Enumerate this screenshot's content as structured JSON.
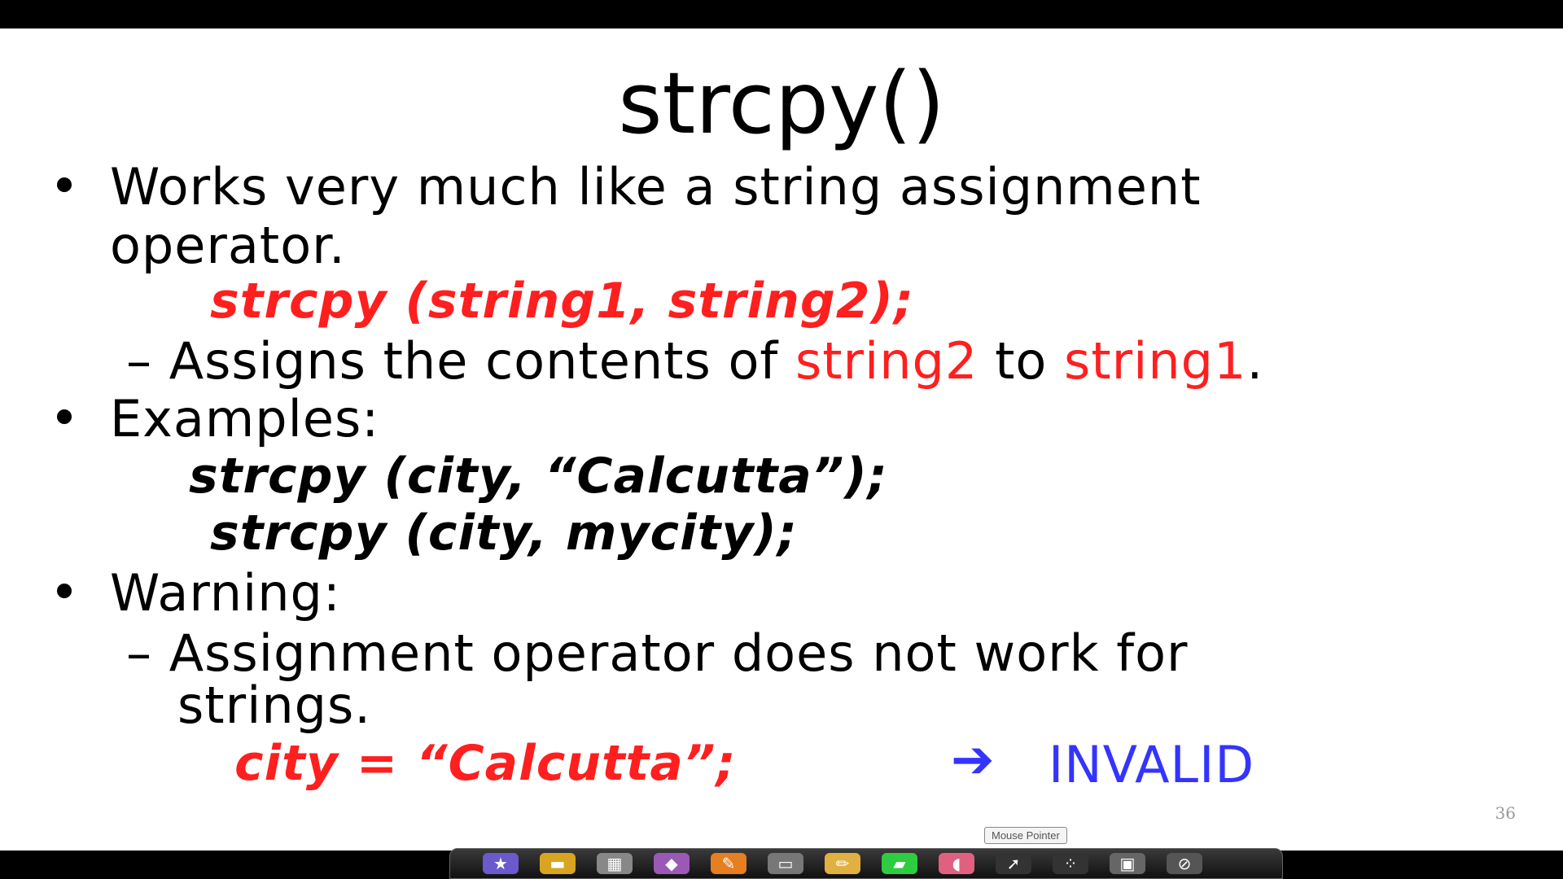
{
  "slide": {
    "title": "strcpy()",
    "bullet1": {
      "line1": "Works very much like a string assignment",
      "line2": "operator."
    },
    "syntax": "strcpy  (string1, string2);",
    "sub1": {
      "dash": "–",
      "text_a": "Assigns the contents of ",
      "red_a": "string2",
      "text_b": " to ",
      "red_b": "string1",
      "text_c": "."
    },
    "bullet2": "Examples:",
    "example1": "strcpy  (city, “Calcutta”);",
    "example2": "strcpy  (city, mycity);",
    "bullet3": "Warning:",
    "sub2": {
      "dash": "–",
      "line1": "Assignment operator does  not work for",
      "line2": "strings."
    },
    "invalid_code": "city  =  “Calcutta”;",
    "arrow": "➔",
    "invalid_label": "INVALID",
    "page_number": "36"
  },
  "taskbar": {
    "tooltip": "Mouse Pointer",
    "icons": [
      "star-icon",
      "folder-icon",
      "save-icon",
      "eraser-icon",
      "pen-icon",
      "screen-icon",
      "pencil-icon",
      "highlighter-icon",
      "eraser-pink-icon",
      "pointer-icon",
      "dots-icon",
      "window-icon",
      "stop-icon"
    ]
  },
  "colors": {
    "red": "#ff1f1f",
    "blue": "#3434ff"
  }
}
